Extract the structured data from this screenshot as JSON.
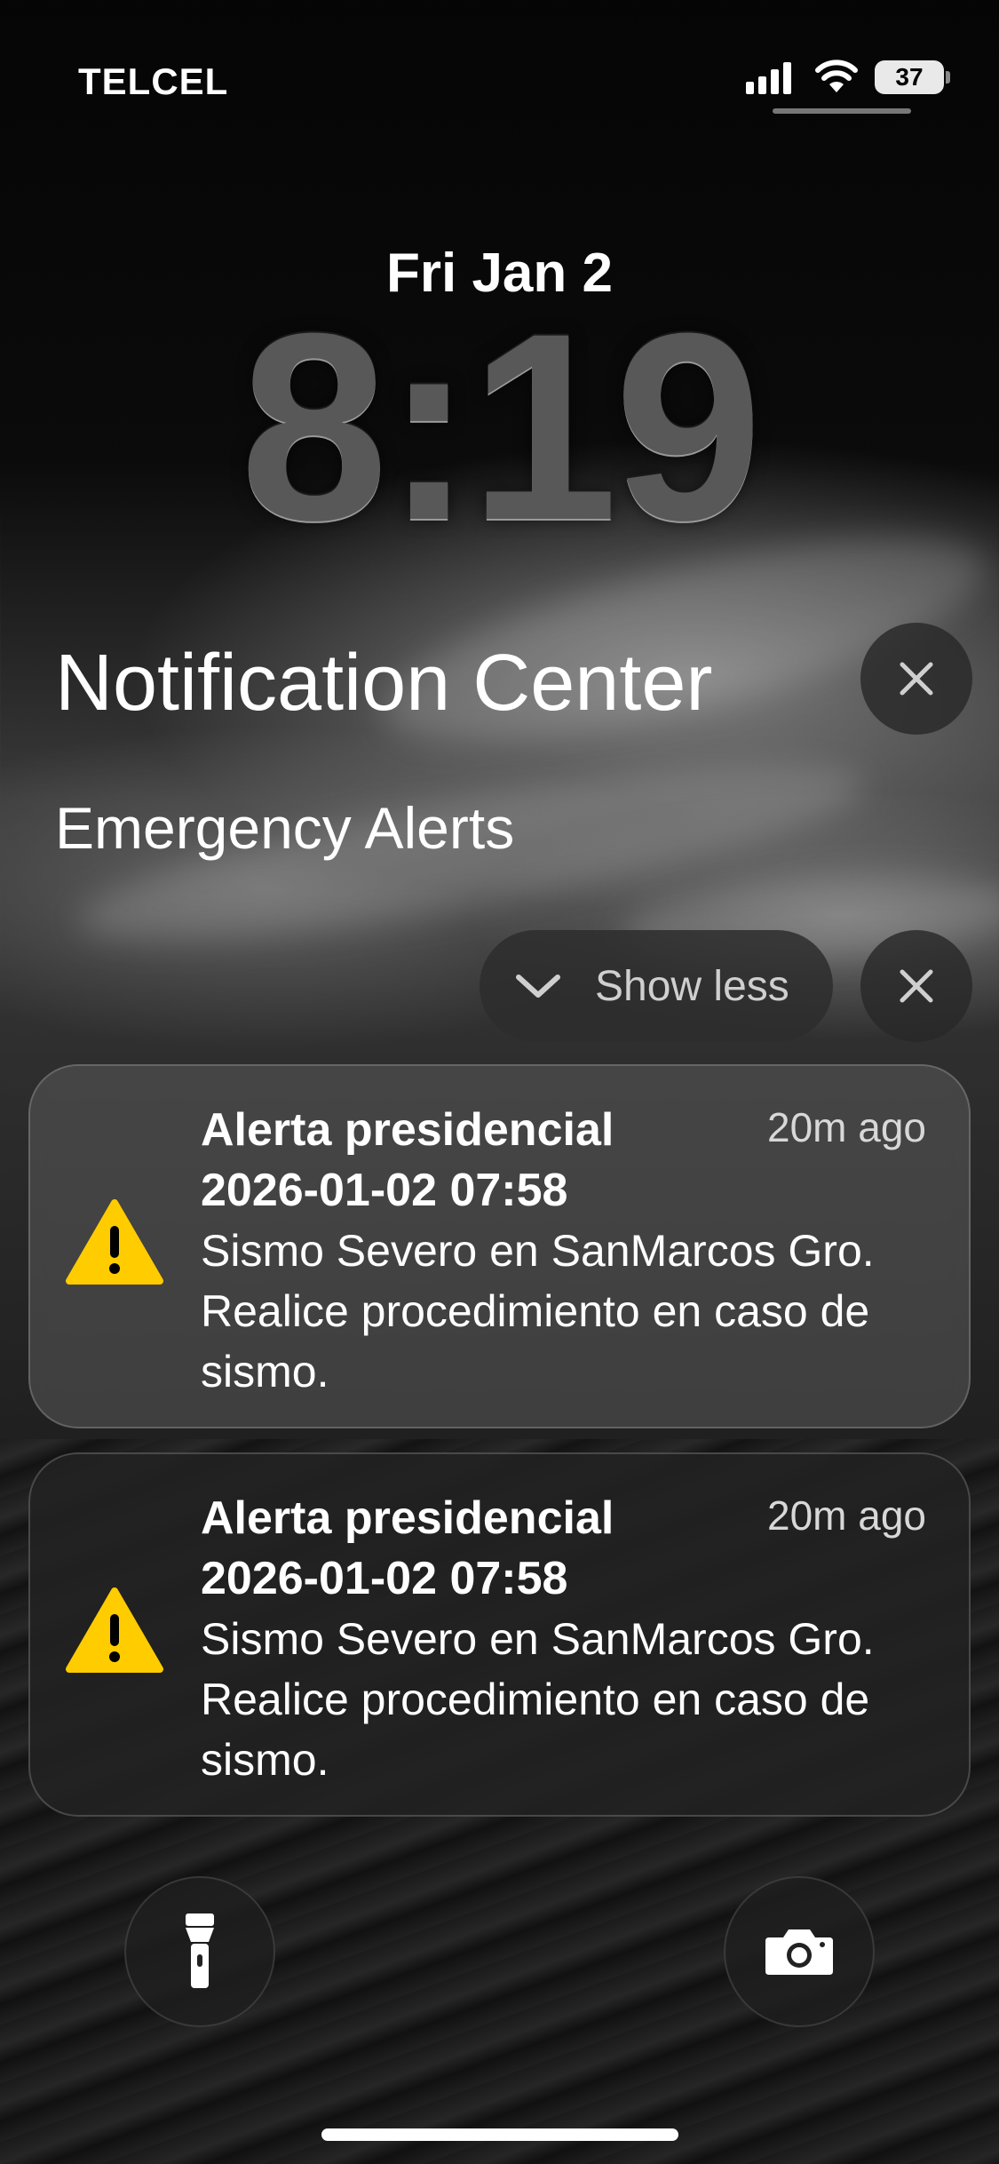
{
  "status_bar": {
    "carrier": "TELCEL",
    "battery": "37",
    "signal_icon": "signal-bars-icon",
    "wifi_icon": "wifi-icon"
  },
  "lock_screen": {
    "date": "Fri Jan 2",
    "time": "8:19"
  },
  "notification_center": {
    "title": "Notification Center",
    "close_icon": "close-icon",
    "group": {
      "title": "Emergency Alerts",
      "show_less_label": "Show less",
      "notifications": [
        {
          "title_line1": "Alerta presidencial",
          "title_line2": "2026-01-02 07:58",
          "time_ago": "20m ago",
          "body": "Sismo Severo en SanMarcos Gro. Realice procedimiento en caso de sismo.",
          "icon": "warning-icon"
        },
        {
          "title_line1": "Alerta presidencial",
          "title_line2": "2026-01-02 07:58",
          "time_ago": "20m ago",
          "body": "Sismo Severo en SanMarcos Gro. Realice procedimiento en caso de sismo.",
          "icon": "warning-icon"
        }
      ]
    }
  },
  "quick_actions": {
    "left_icon": "flashlight-icon",
    "right_icon": "camera-icon"
  },
  "colors": {
    "warning_yellow": "#FFCC00",
    "text": "#FFFFFF"
  }
}
